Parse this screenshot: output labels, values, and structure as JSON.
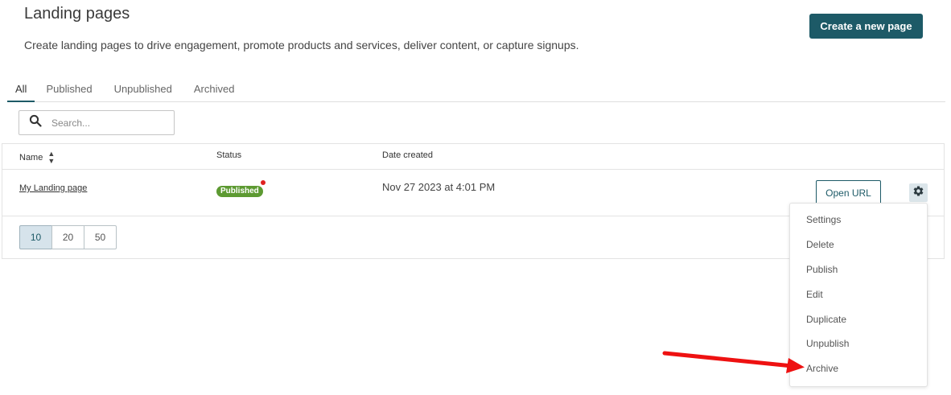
{
  "header": {
    "title": "Landing pages",
    "description": "Create landing pages to drive engagement, promote products and services, deliver content, or capture signups.",
    "create_button": "Create a new page"
  },
  "tabs": [
    {
      "label": "All",
      "active": true
    },
    {
      "label": "Published",
      "active": false
    },
    {
      "label": "Unpublished",
      "active": false
    },
    {
      "label": "Archived",
      "active": false
    }
  ],
  "search": {
    "placeholder": "Search...",
    "value": "",
    "icon": "search-icon"
  },
  "table": {
    "columns": {
      "name": "Name",
      "status": "Status",
      "date": "Date created"
    },
    "rows": [
      {
        "name": "My Landing page",
        "status": "Published",
        "date_created": "Nov 27 2023 at 4:01 PM",
        "open_url_label": "Open URL",
        "actions_icon": "gear-icon"
      }
    ]
  },
  "pagination": {
    "sizes": [
      "10",
      "20",
      "50"
    ],
    "selected": "10"
  },
  "context_menu": {
    "items": [
      "Settings",
      "Delete",
      "Publish",
      "Edit",
      "Duplicate",
      "Unpublish",
      "Archive"
    ]
  },
  "colors": {
    "primary": "#1d5a67",
    "published_badge": "#5d9a32",
    "notification_dot": "#e02020",
    "annotation_arrow": "#ee1111",
    "pager_active_bg": "#d6e3eb"
  }
}
